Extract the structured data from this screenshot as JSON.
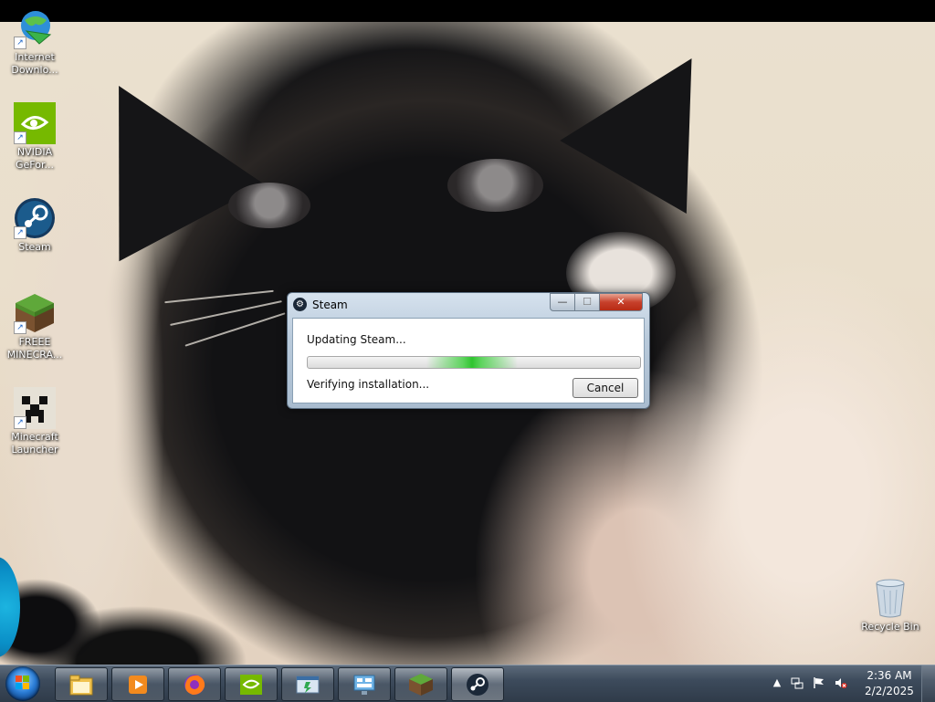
{
  "desktop": {
    "icons": [
      {
        "name": "internet-download-manager",
        "label_1": "Internet",
        "label_2": "Downlo..."
      },
      {
        "name": "nvidia-geforce",
        "label_1": "NVIDIA",
        "label_2": "GeFor..."
      },
      {
        "name": "steam",
        "label_1": "Steam",
        "label_2": ""
      },
      {
        "name": "freee-minecraft",
        "label_1": "FREEE",
        "label_2": "MINECRA..."
      },
      {
        "name": "minecraft-launcher",
        "label_1": "Minecraft",
        "label_2": "Launcher"
      },
      {
        "name": "recycle-bin",
        "label_1": "Recycle Bin",
        "label_2": ""
      }
    ]
  },
  "dialog": {
    "title": "Steam",
    "status_line": "Updating Steam...",
    "detail_line": "Verifying installation...",
    "cancel_label": "Cancel",
    "minimize_glyph": "—",
    "maximize_glyph": "☐",
    "close_glyph": "✕"
  },
  "taskbar": {
    "pinned": [
      {
        "name": "windows-explorer",
        "icon": "folder-icon"
      },
      {
        "name": "media-player",
        "icon": "media-player-icon"
      },
      {
        "name": "firefox",
        "icon": "firefox-icon"
      },
      {
        "name": "nvidia",
        "icon": "nvidia-icon"
      },
      {
        "name": "app-window",
        "icon": "app-window-icon"
      },
      {
        "name": "control-panel",
        "icon": "control-panel-icon"
      },
      {
        "name": "minecraft",
        "icon": "minecraft-grass-icon"
      },
      {
        "name": "steam",
        "icon": "steam-icon"
      }
    ],
    "tray": {
      "show_hidden_glyph": "▲",
      "clock_time": "2:36 AM",
      "clock_date": "2/2/2025"
    }
  },
  "colors": {
    "progress_green": "#2fc42f",
    "close_red": "#c7402b",
    "taskbar": "#3d4b5c"
  }
}
